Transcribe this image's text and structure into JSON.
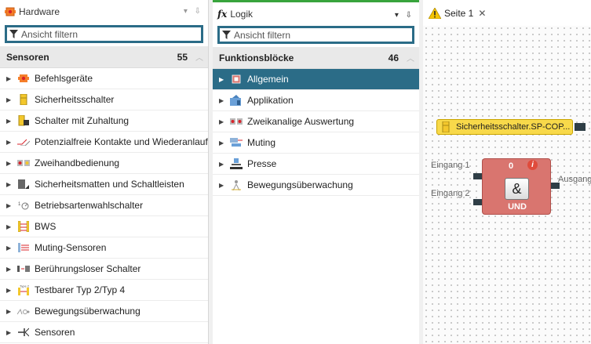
{
  "hardware_panel": {
    "title": "Hardware",
    "controls": "▾ ⇩",
    "filter_placeholder": "Ansicht filtern",
    "category": {
      "label": "Sensoren",
      "count": "55",
      "collapse": "︿"
    },
    "items": [
      {
        "label": "Befehlsgeräte",
        "icon": "command-device-icon"
      },
      {
        "label": "Sicherheitsschalter",
        "icon": "safety-switch-icon"
      },
      {
        "label": "Schalter mit Zuhaltung",
        "icon": "locking-switch-icon"
      },
      {
        "label": "Potenzialfreie Kontakte und Wiederanlauf",
        "icon": "potential-free-contacts-icon"
      },
      {
        "label": "Zweihandbedienung",
        "icon": "two-hand-control-icon"
      },
      {
        "label": "Sicherheitsmatten und Schaltleisten",
        "icon": "safety-mat-icon"
      },
      {
        "label": "Betriebsartenwahlschalter",
        "icon": "mode-selector-icon"
      },
      {
        "label": "BWS",
        "icon": "light-curtain-icon"
      },
      {
        "label": "Muting-Sensoren",
        "icon": "muting-sensor-icon"
      },
      {
        "label": "Berührungsloser Schalter",
        "icon": "contactless-switch-icon"
      },
      {
        "label": "Testbarer Typ 2/Typ 4",
        "icon": "testable-type-icon"
      },
      {
        "label": "Bewegungsüberwachung",
        "icon": "motion-monitoring-icon"
      },
      {
        "label": "Sensoren",
        "icon": "sensor-icon"
      }
    ]
  },
  "logic_panel": {
    "title_prefix": "fx",
    "title": "Logik",
    "controls": "▾ ⇩",
    "filter_placeholder": "Ansicht filtern",
    "category": {
      "label": "Funktionsblöcke",
      "count": "46",
      "collapse": "︿"
    },
    "items": [
      {
        "label": "Allgemein",
        "icon": "general-block-icon",
        "selected": true
      },
      {
        "label": "Applikation",
        "icon": "application-icon"
      },
      {
        "label": "Zweikanalige Auswertung",
        "icon": "dual-channel-icon"
      },
      {
        "label": "Muting",
        "icon": "muting-icon"
      },
      {
        "label": "Presse",
        "icon": "press-icon"
      },
      {
        "label": "Bewegungsüberwachung",
        "icon": "motion-monitoring-icon"
      }
    ]
  },
  "canvas": {
    "tab_label": "Seite 1",
    "tab_close": "✕",
    "sensor_block_label": "Sicherheitsschalter.SP-COP...",
    "und_block": {
      "count": "0",
      "info": "i",
      "gate_symbol": "&",
      "label": "UND",
      "input1": "Eingang 1",
      "input2": "Eingang 2",
      "output": "Ausgang"
    }
  },
  "colors": {
    "accent": "#2b6c87",
    "logic_tab_bar": "#38a43c",
    "sensor_block": "#f8d94a",
    "und_block": "#d9756f"
  }
}
